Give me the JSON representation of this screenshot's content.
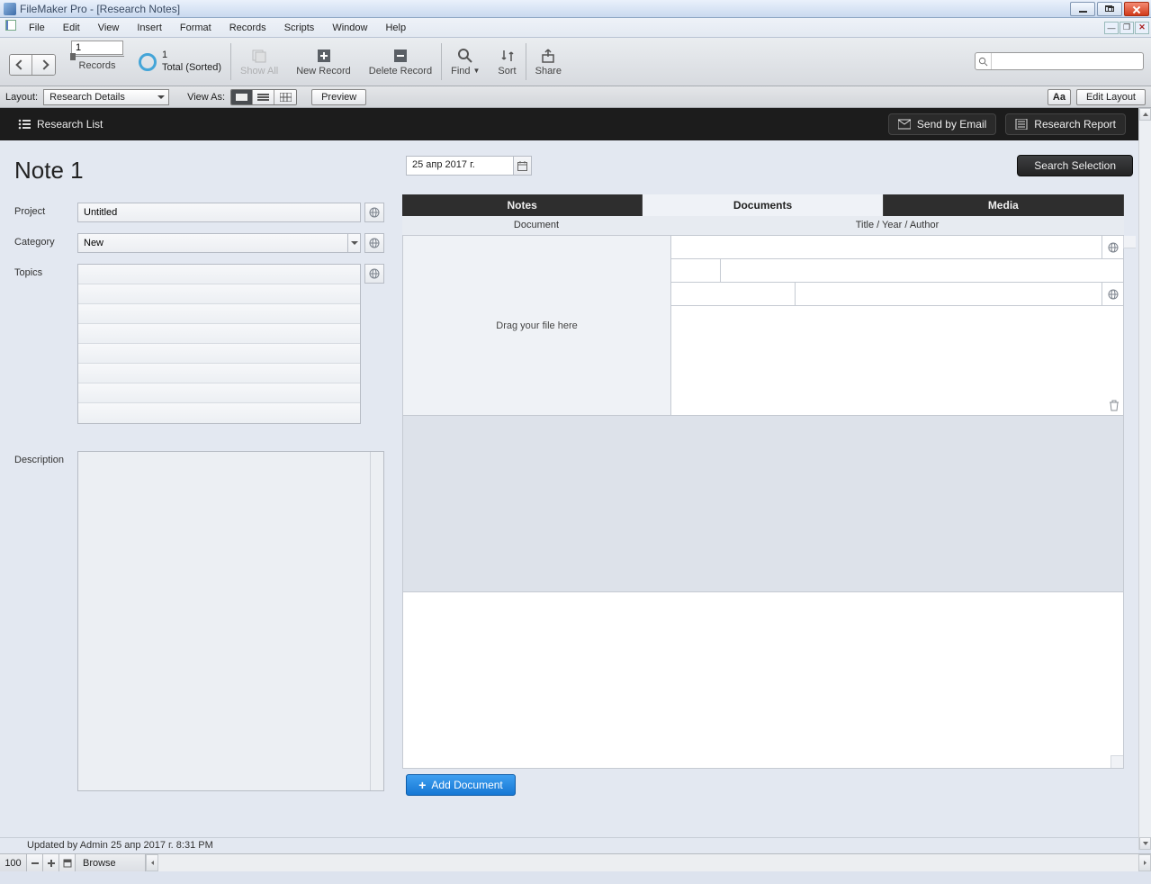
{
  "window": {
    "title": "FileMaker Pro - [Research Notes]"
  },
  "menu": [
    "File",
    "Edit",
    "View",
    "Insert",
    "Format",
    "Records",
    "Scripts",
    "Window",
    "Help"
  ],
  "toolbar": {
    "record_value": "1",
    "records_label": "Records",
    "pie_count": "1",
    "pie_total": "Total (Sorted)",
    "show_all": "Show All",
    "new_record": "New Record",
    "delete_record": "Delete Record",
    "find": "Find",
    "sort": "Sort",
    "share": "Share"
  },
  "layoutbar": {
    "layout_label": "Layout:",
    "layout_value": "Research Details",
    "view_as": "View As:",
    "preview": "Preview",
    "aa": "Aa",
    "edit_layout": "Edit Layout"
  },
  "blackbar": {
    "research_list": "Research List",
    "send_email": "Send by Email",
    "research_report": "Research Report"
  },
  "note": {
    "title": "Note 1",
    "date": "25 апр 2017 г.",
    "search_selection": "Search Selection",
    "labels": {
      "project": "Project",
      "category": "Category",
      "topics": "Topics",
      "description": "Description"
    },
    "project_value": "Untitled",
    "category_value": "New"
  },
  "tabs": {
    "notes": "Notes",
    "documents": "Documents",
    "media": "Media"
  },
  "doc_headers": {
    "document": "Document",
    "tya": "Title / Year / Author"
  },
  "dropzone": "Drag your file here",
  "add_document": "Add Document",
  "footer": {
    "updated": "Updated by Admin 25 апр 2017 г. 8:31 PM",
    "zoom": "100",
    "mode": "Browse"
  }
}
